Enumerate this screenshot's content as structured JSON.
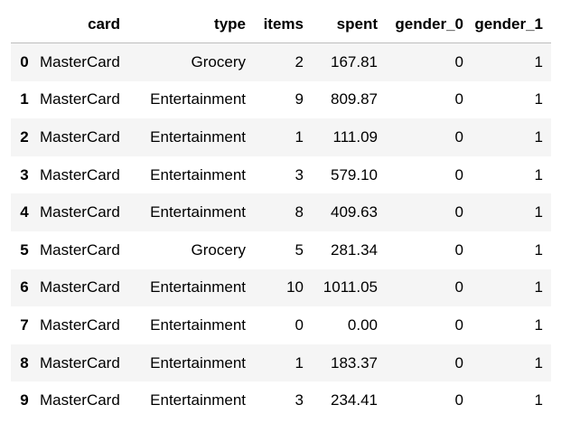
{
  "table": {
    "index_header": "",
    "columns": [
      "card",
      "type",
      "items",
      "spent",
      "gender_0",
      "gender_1"
    ],
    "rows": [
      {
        "index": "0",
        "card": "MasterCard",
        "type": "Grocery",
        "items": "2",
        "spent": "167.81",
        "gender_0": "0",
        "gender_1": "1"
      },
      {
        "index": "1",
        "card": "MasterCard",
        "type": "Entertainment",
        "items": "9",
        "spent": "809.87",
        "gender_0": "0",
        "gender_1": "1"
      },
      {
        "index": "2",
        "card": "MasterCard",
        "type": "Entertainment",
        "items": "1",
        "spent": "111.09",
        "gender_0": "0",
        "gender_1": "1"
      },
      {
        "index": "3",
        "card": "MasterCard",
        "type": "Entertainment",
        "items": "3",
        "spent": "579.10",
        "gender_0": "0",
        "gender_1": "1"
      },
      {
        "index": "4",
        "card": "MasterCard",
        "type": "Entertainment",
        "items": "8",
        "spent": "409.63",
        "gender_0": "0",
        "gender_1": "1"
      },
      {
        "index": "5",
        "card": "MasterCard",
        "type": "Grocery",
        "items": "5",
        "spent": "281.34",
        "gender_0": "0",
        "gender_1": "1"
      },
      {
        "index": "6",
        "card": "MasterCard",
        "type": "Entertainment",
        "items": "10",
        "spent": "1011.05",
        "gender_0": "0",
        "gender_1": "1"
      },
      {
        "index": "7",
        "card": "MasterCard",
        "type": "Entertainment",
        "items": "0",
        "spent": "0.00",
        "gender_0": "0",
        "gender_1": "1"
      },
      {
        "index": "8",
        "card": "MasterCard",
        "type": "Entertainment",
        "items": "1",
        "spent": "183.37",
        "gender_0": "0",
        "gender_1": "1"
      },
      {
        "index": "9",
        "card": "MasterCard",
        "type": "Entertainment",
        "items": "3",
        "spent": "234.41",
        "gender_0": "0",
        "gender_1": "1"
      }
    ]
  },
  "colors": {
    "row_stripe": "#f5f5f5",
    "header_rule": "#bdbdbd",
    "text": "#000000"
  }
}
